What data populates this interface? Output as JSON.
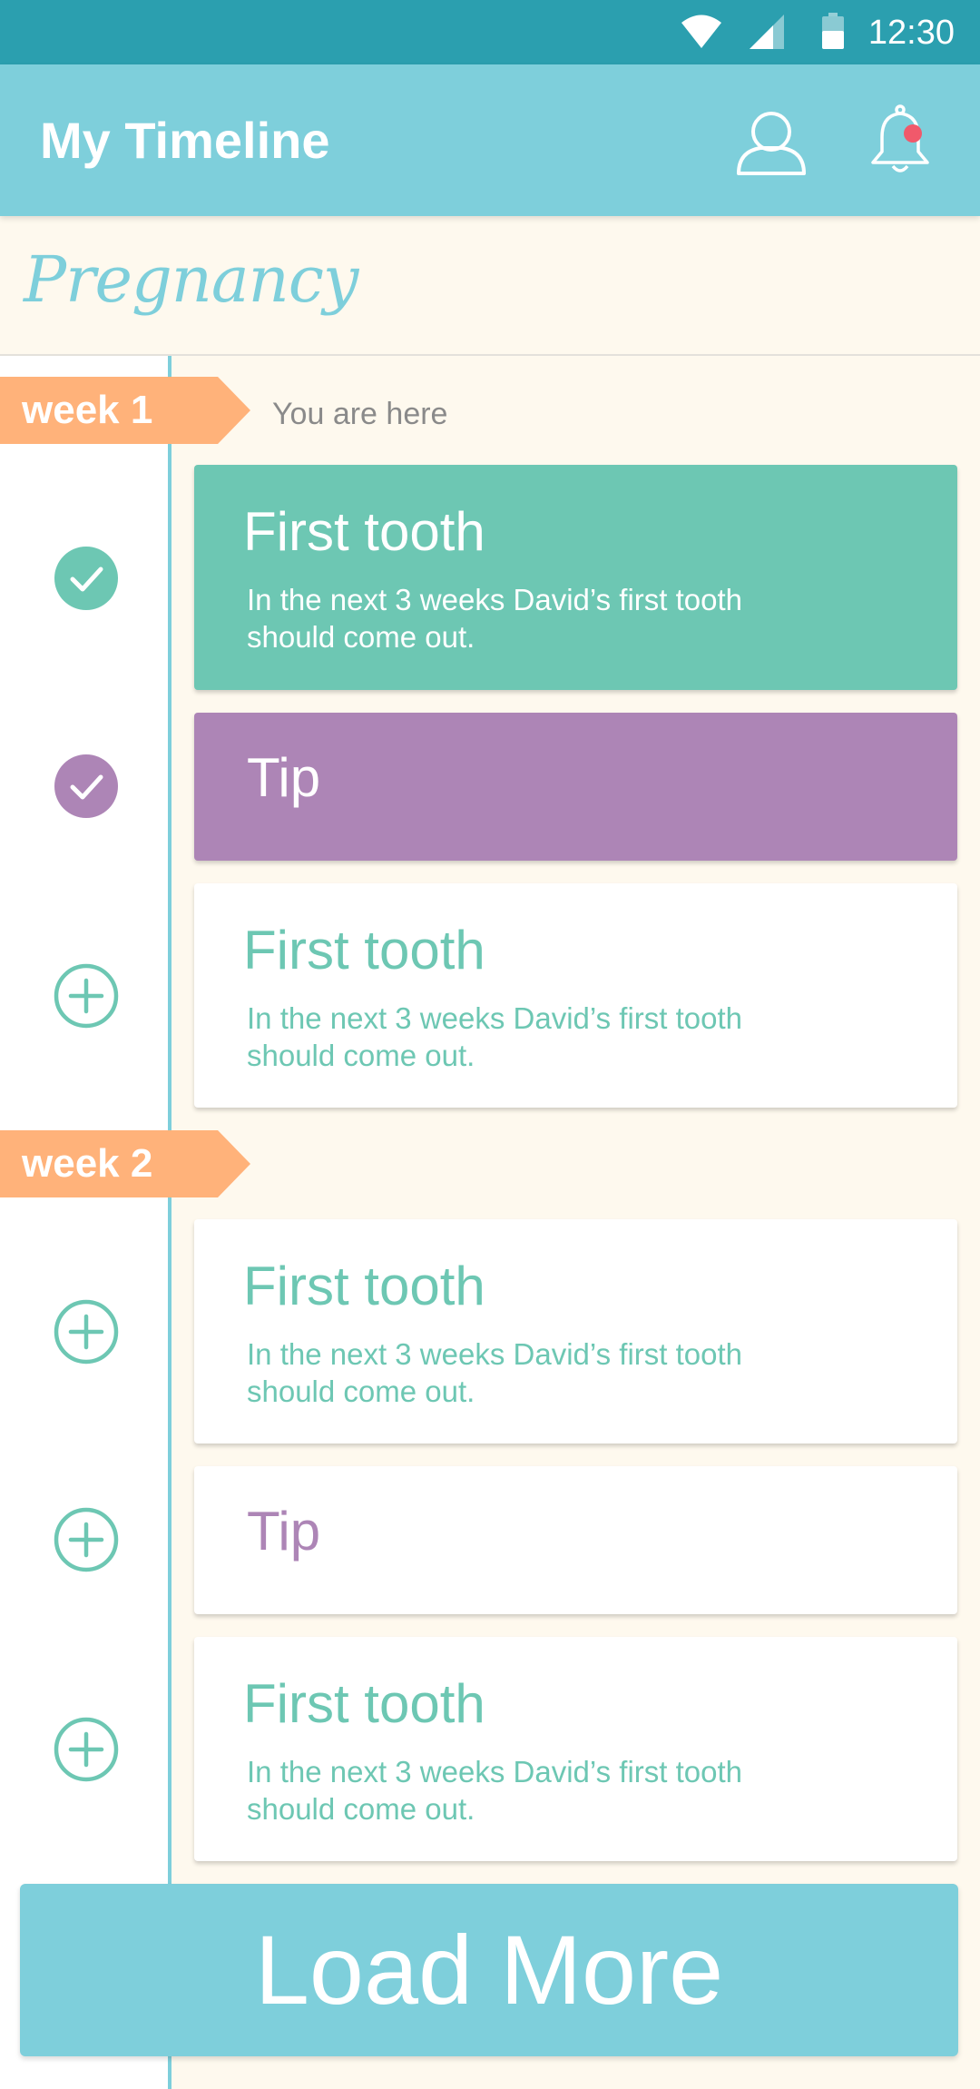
{
  "status_bar": {
    "time": "12:30",
    "wifi_icon": "wifi-icon",
    "signal_icon": "cell-signal-icon",
    "battery_icon": "battery-icon"
  },
  "app_bar": {
    "title": "My Timeline",
    "profile_icon": "profile-icon",
    "notification_icon": "bell-icon"
  },
  "section": {
    "title": "Pregnancy"
  },
  "weeks": [
    {
      "label": "week 1",
      "marker_text": "You are here"
    },
    {
      "label": "week 2"
    }
  ],
  "cards": [
    {
      "type": "milestone",
      "state": "done",
      "title": "First tooth",
      "body": "In the next 3 weeks David’s first tooth should come out."
    },
    {
      "type": "tip",
      "state": "done",
      "title": "Tip"
    },
    {
      "type": "milestone",
      "state": "todo",
      "title": "First tooth",
      "body": "In the next 3 weeks David’s first tooth should come out."
    },
    {
      "type": "milestone",
      "state": "todo",
      "title": "First tooth",
      "body": "In the next 3 weeks David’s first tooth should come out."
    },
    {
      "type": "tip",
      "state": "todo",
      "title": "Tip"
    },
    {
      "type": "milestone",
      "state": "todo",
      "title": "First tooth",
      "body": "In the next 3 weeks David’s first tooth should come out."
    }
  ],
  "load_more": {
    "label": "Load More"
  },
  "colors": {
    "status_bar": "#2b9faf",
    "app_bar": "#7ecfdb",
    "background": "#fef9ee",
    "accent_green": "#6dc7b3",
    "accent_purple": "#ad85b6",
    "week_tag": "#ffb27a",
    "notification_dot": "#f0596b",
    "marker_text": "#8a8a8a"
  }
}
